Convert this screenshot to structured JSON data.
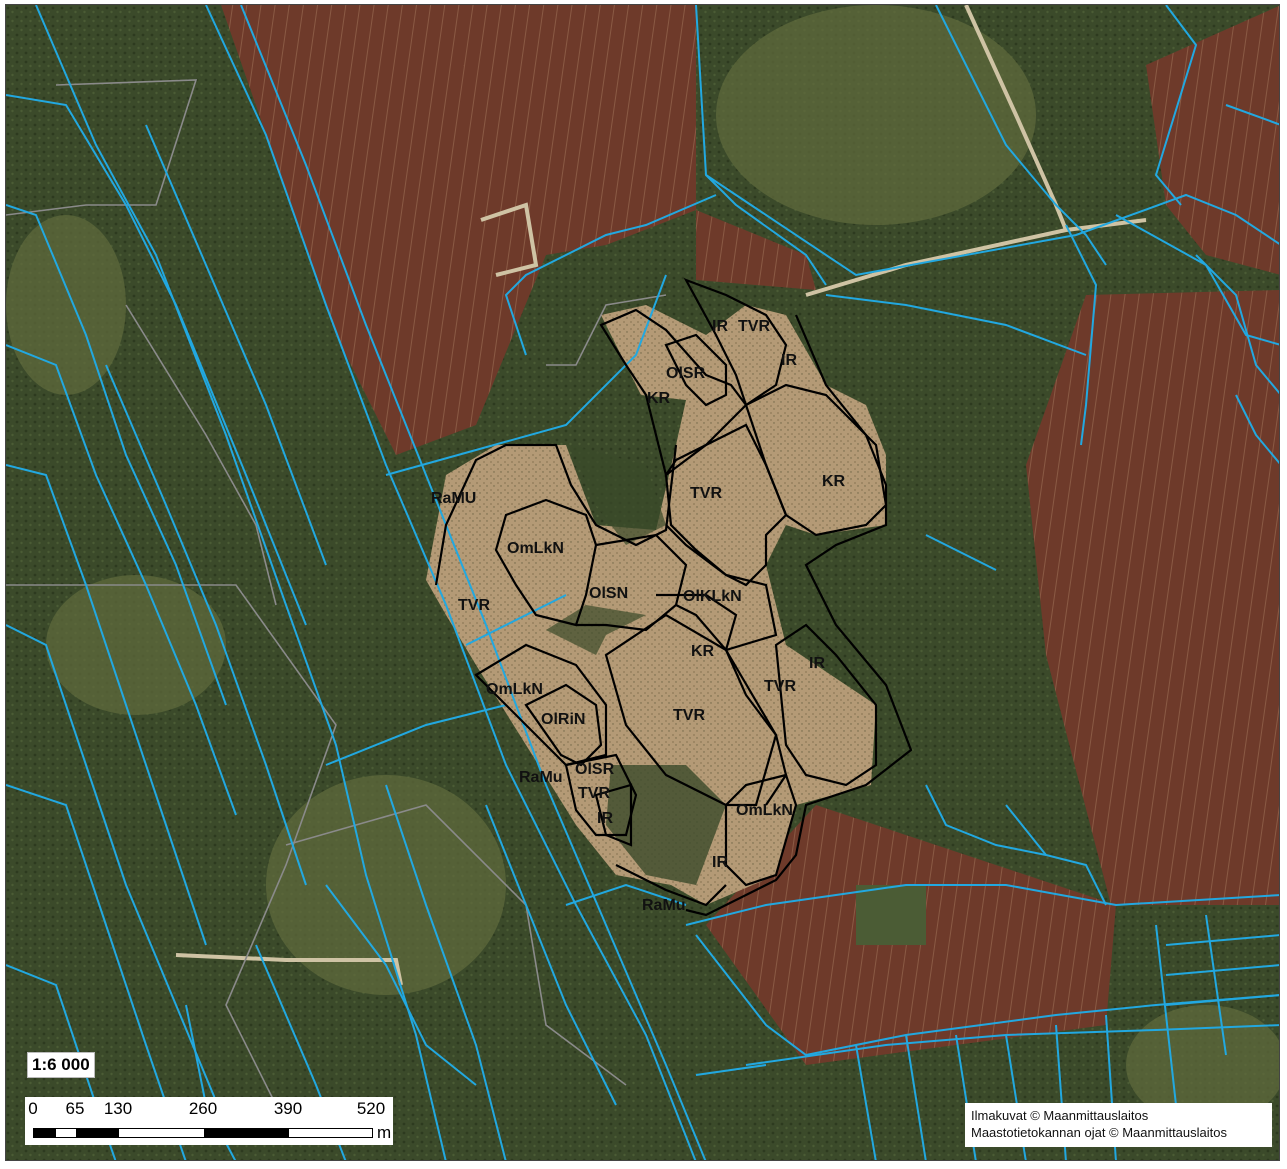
{
  "map": {
    "scale_ratio": "1:6 000",
    "scale_bar": {
      "ticks": [
        "0",
        "65",
        "130",
        "260",
        "390",
        "520"
      ],
      "unit": "m"
    },
    "credits": [
      "Ilmakuvat © Maanmittauslaitos",
      "Maastotietokannan ojat © Maanmittauslaitos"
    ],
    "colors": {
      "forest": "#3b4a2a",
      "peat_field": "#6e3a2a",
      "bog": "#b49a76",
      "ditch_lines": "#22a8e0",
      "parcel_lines": "#8a8a8a",
      "site_boundaries": "#000000"
    },
    "site_labels": [
      "IR",
      "TVR",
      "IR",
      "OlSR",
      "KR",
      "KR",
      "TVR",
      "RaMU",
      "OmLkN",
      "OlSN",
      "OlKLkN",
      "TVR",
      "KR",
      "IR",
      "TVR",
      "TVR",
      "OmLkN",
      "OlRiN",
      "RaMu",
      "OlSR",
      "TVR",
      "IR",
      "OmLkN",
      "IR",
      "RaMu"
    ]
  }
}
